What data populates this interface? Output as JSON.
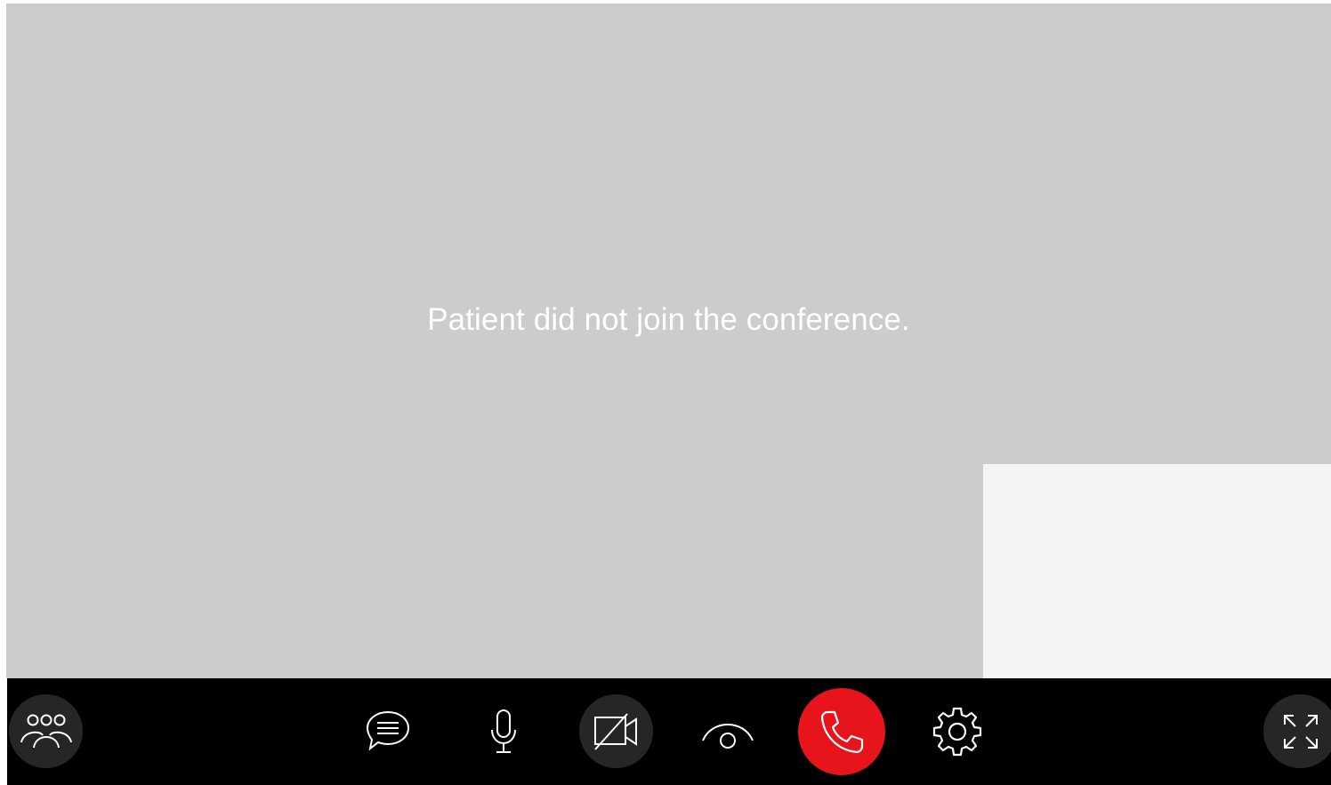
{
  "stage": {
    "status_message": "Patient did not join the conference."
  },
  "controls": {
    "participants": {
      "icon": "participants-icon"
    },
    "chat": {
      "icon": "chat-icon"
    },
    "microphone": {
      "icon": "microphone-icon"
    },
    "camera": {
      "icon": "camera-off-icon",
      "state": "off"
    },
    "view_toggle": {
      "icon": "view-icon"
    },
    "end_call": {
      "icon": "phone-icon",
      "color": "#e8141b"
    },
    "settings": {
      "icon": "gear-icon"
    },
    "fullscreen": {
      "icon": "expand-icon"
    }
  },
  "colors": {
    "video_background": "#cccccc",
    "self_view_background": "#f4f4f4",
    "control_bar": "#000000",
    "control_button": "#262626",
    "end_call": "#e8141b"
  }
}
